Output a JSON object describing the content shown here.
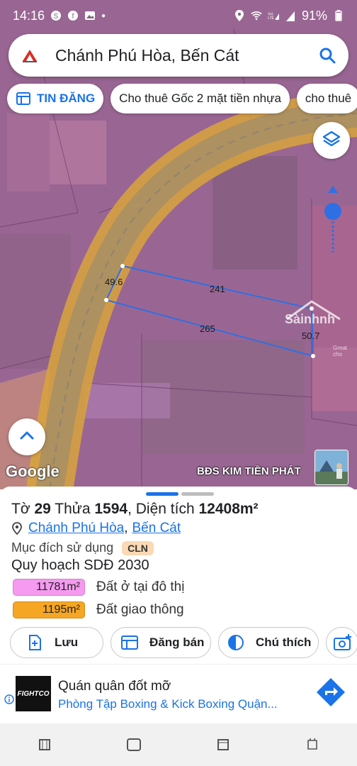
{
  "status_bar": {
    "time": "14:16",
    "battery": "91%"
  },
  "search": {
    "query": "Chánh Phú Hòa, Bến Cát"
  },
  "chips": [
    {
      "label": "TIN ĐĂNG"
    },
    {
      "label": "Cho thuê Gốc 2 mặt tiền nhựa"
    },
    {
      "label": "cho thuê"
    }
  ],
  "map": {
    "dimensions": {
      "top": "241",
      "bottom": "265",
      "left": "49.6",
      "right": "50.7"
    },
    "google_label": "Google",
    "watermark": "BĐS KIM TIỀN PHÁT",
    "logo_watermark": "Sàinhnh",
    "logo_watermark_sub": "Great cho"
  },
  "parcel": {
    "sheet_label": "Tờ",
    "sheet_no": "29",
    "lot_label": "Thửa",
    "lot_no": "1594",
    "area_label": ", Diện tích",
    "area": "12408m²",
    "ward": "Chánh Phú Hòa",
    "district": "Bến Cát",
    "usage_label": "Mục đích sử dụng",
    "usage_code": "CLN",
    "plan_title": "Quy hoạch SDĐ 2030",
    "plan_items": [
      {
        "area": "11781m²",
        "label": "Đất ở tại đô thị",
        "color": "#f59af0"
      },
      {
        "area": "1195m²",
        "label": "Đất giao thông",
        "color": "#f5a623"
      }
    ]
  },
  "actions": [
    {
      "label": "Lưu",
      "icon": "save-add-icon"
    },
    {
      "label": "Đăng bán",
      "icon": "listing-icon"
    },
    {
      "label": "Chú thích",
      "icon": "legend-icon"
    },
    {
      "label": "",
      "icon": "add-photo-icon"
    }
  ],
  "ad": {
    "logo_text": "FIGHTCO",
    "title": "Quán quân đốt mỡ",
    "subtitle": "Phòng Tập Boxing & Kick Boxing Quận..."
  },
  "colors": {
    "accent": "#1a73e8",
    "residential": "#f59af0",
    "road": "#f5a623",
    "parcel_outline": "#2f6fe4"
  }
}
